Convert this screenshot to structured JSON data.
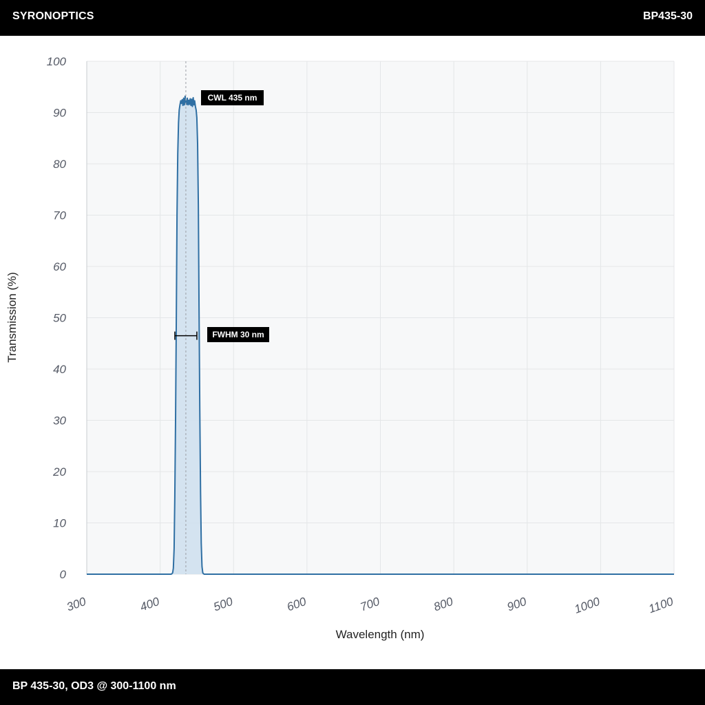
{
  "header": {
    "brand": "SYRONOPTICS",
    "part_number": "BP435-30"
  },
  "footer": {
    "caption": "BP 435-30, OD3 @ 300-1100 nm"
  },
  "colors": {
    "curve": "#2f6fa3",
    "fill": "#cfe0ee",
    "plot_background": "#f7f8f9",
    "grid": "#e4e6e8",
    "bars": "#000000"
  },
  "chart_data": {
    "type": "area",
    "xlabel": "Wavelength (nm)",
    "ylabel": "Transmission (%)",
    "xlim": [
      300,
      1100
    ],
    "ylim": [
      0,
      100
    ],
    "xticks": [
      300,
      400,
      500,
      600,
      700,
      800,
      900,
      1000,
      1100
    ],
    "yticks": [
      0,
      10,
      20,
      30,
      40,
      50,
      60,
      70,
      80,
      90,
      100
    ],
    "grid": true,
    "series": [
      {
        "x": [
          300,
          350,
          400,
          415,
          416,
          417,
          418,
          419,
          420,
          421,
          422,
          423,
          424,
          425,
          426,
          427,
          428,
          429,
          430,
          431,
          432,
          433,
          434,
          435,
          436,
          437,
          438,
          439,
          440,
          441,
          442,
          443,
          444,
          445,
          446,
          447,
          448,
          449,
          450,
          451,
          452,
          453,
          454,
          455,
          456,
          457,
          458,
          459,
          460,
          461,
          462,
          463,
          464,
          470,
          500,
          550,
          600,
          650,
          700,
          750,
          800,
          850,
          900,
          950,
          1000,
          1050,
          1100
        ],
        "y": [
          0,
          0,
          0,
          0,
          0.1,
          0.3,
          1.2,
          5,
          15,
          30,
          50,
          70,
          82,
          88,
          90.5,
          91.5,
          92.3,
          91.8,
          92.5,
          91.4,
          92.8,
          91.5,
          93.2,
          92.0,
          91.6,
          92.8,
          91.5,
          92.4,
          91.6,
          92.7,
          91.4,
          92.6,
          91.2,
          92.9,
          91.5,
          92.3,
          91.2,
          90.5,
          89,
          84,
          72,
          52,
          32,
          16,
          6,
          1.5,
          0.3,
          0.1,
          0,
          0,
          0,
          0,
          0,
          0,
          0,
          0,
          0,
          0,
          0,
          0,
          0,
          0,
          0,
          0,
          0,
          0,
          0
        ]
      }
    ],
    "annotations": [
      {
        "label": "CWL 435 nm",
        "x": 435,
        "y": 92.5
      },
      {
        "label": "FWHM 30 nm",
        "x_start": 420,
        "x_end": 450,
        "y": 46.5
      }
    ]
  }
}
